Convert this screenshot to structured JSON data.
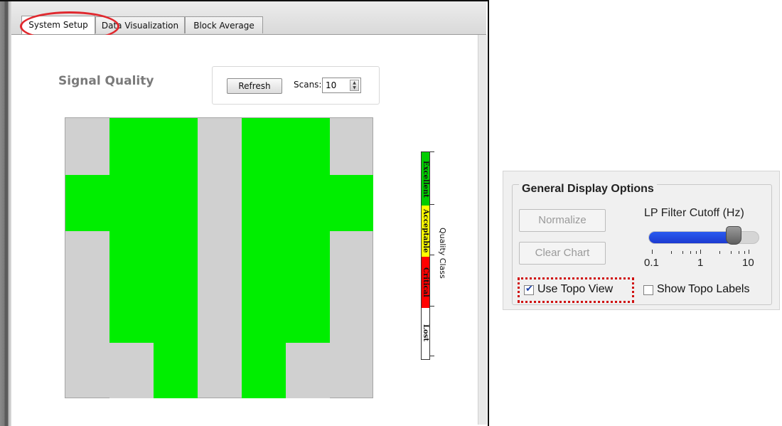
{
  "tabs": [
    {
      "label": "System Setup",
      "active": true
    },
    {
      "label": "Data Visualization",
      "active": false
    },
    {
      "label": "Block Average",
      "active": false
    }
  ],
  "signal_quality": {
    "title": "Signal Quality",
    "refresh_label": "Refresh",
    "scans_label": "Scans:",
    "scans_value": "10"
  },
  "quality_scale": {
    "axis_label": "Quality Class",
    "classes": [
      {
        "label": "Excellent",
        "color": "#00cc00"
      },
      {
        "label": "Acceptable",
        "color": "#ffff00"
      },
      {
        "label": "Critical",
        "color": "#ff0000"
      },
      {
        "label": "Lost",
        "color": "#ffffff"
      }
    ]
  },
  "topo_colors": {
    "good": "#00ee00",
    "off": "#d0d0d0"
  },
  "display_options": {
    "title": "General Display Options",
    "normalize_label": "Normalize",
    "clear_chart_label": "Clear Chart",
    "lp_filter_label": "LP Filter Cutoff (Hz)",
    "lp_slider_fraction": 0.78,
    "scale_labels": [
      "0.1",
      "1",
      "10"
    ],
    "use_topo_view_label": "Use Topo View",
    "use_topo_view_checked": true,
    "show_topo_labels_label": "Show Topo Labels",
    "show_topo_labels_checked": false
  }
}
